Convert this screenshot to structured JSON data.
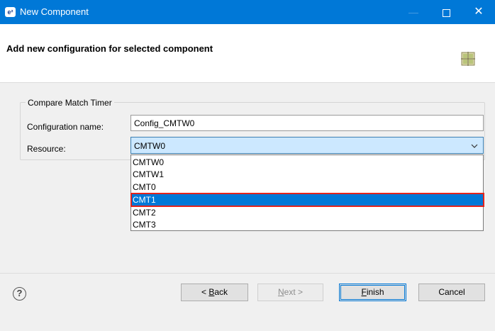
{
  "window": {
    "title": "New Component",
    "app_icon": "e²-studio-icon",
    "min_symbol": "—",
    "close_symbol": "✕"
  },
  "header": {
    "title": "Add new configuration for selected component",
    "icon": "component-grid-icon"
  },
  "form": {
    "group_label": "Compare Match Timer",
    "config_name_label": "Configuration name:",
    "config_name_value": "Config_CMTW0",
    "resource_label": "Resource:",
    "resource_value": "CMTW0",
    "resource_options": [
      "CMTW0",
      "CMTW1",
      "CMT0",
      "CMT1",
      "CMT2",
      "CMT3"
    ],
    "highlighted_option": "CMT1"
  },
  "footer": {
    "help_symbol": "?",
    "back": {
      "prefix": "< ",
      "mnemonic": "B",
      "rest": "ack"
    },
    "next": {
      "mnemonic": "N",
      "rest": "ext >"
    },
    "finish": {
      "mnemonic": "F",
      "rest": "inish"
    },
    "cancel": "Cancel"
  },
  "colors": {
    "titlebar": "#0078d7",
    "selection": "#0078d7",
    "highlight_outline": "#e3241c",
    "combo_bg": "#cce8ff"
  }
}
